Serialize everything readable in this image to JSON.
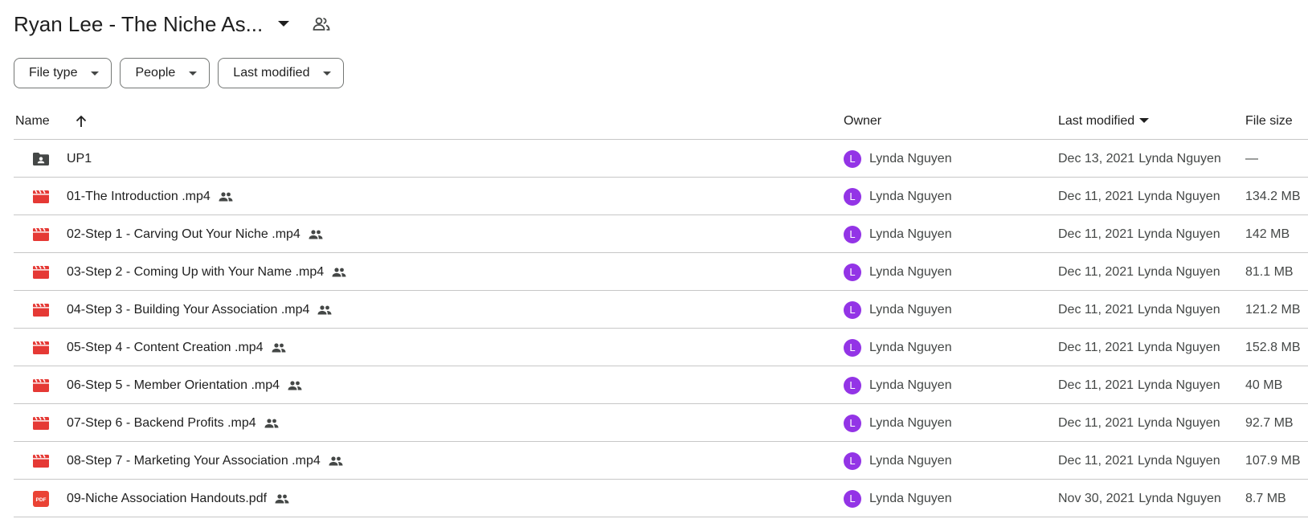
{
  "header": {
    "title": "Ryan Lee - The Niche As...",
    "title_caret_icon": "arrow-drop-down-icon",
    "shared_icon": "shared-folder-icon"
  },
  "filters": [
    {
      "label": "File type"
    },
    {
      "label": "People"
    },
    {
      "label": "Last modified"
    }
  ],
  "columns": {
    "name": "Name",
    "owner": "Owner",
    "last_modified": "Last modified",
    "file_size": "File size"
  },
  "sort": {
    "column": "Name",
    "direction": "ascending",
    "icon": "arrow-upward-icon"
  },
  "colors": {
    "accent_avatar": "#9334e6",
    "video_icon": "#e53935",
    "pdf_icon": "#ea4335",
    "folder_icon": "#444746"
  },
  "rows": [
    {
      "type": "shared-folder",
      "name": "UP1",
      "shared": false,
      "owner_initial": "L",
      "owner": "Lynda Nguyen",
      "modified_date": "Dec 13, 2021",
      "modified_by": "Lynda Nguyen",
      "size": "—"
    },
    {
      "type": "video",
      "name": "01-The Introduction .mp4",
      "shared": true,
      "owner_initial": "L",
      "owner": "Lynda Nguyen",
      "modified_date": "Dec 11, 2021",
      "modified_by": "Lynda Nguyen",
      "size": "134.2 MB"
    },
    {
      "type": "video",
      "name": "02-Step 1 - Carving Out Your Niche .mp4",
      "shared": true,
      "owner_initial": "L",
      "owner": "Lynda Nguyen",
      "modified_date": "Dec 11, 2021",
      "modified_by": "Lynda Nguyen",
      "size": "142 MB"
    },
    {
      "type": "video",
      "name": "03-Step 2 - Coming Up with Your Name .mp4",
      "shared": true,
      "owner_initial": "L",
      "owner": "Lynda Nguyen",
      "modified_date": "Dec 11, 2021",
      "modified_by": "Lynda Nguyen",
      "size": "81.1 MB"
    },
    {
      "type": "video",
      "name": "04-Step 3 - Building Your Association .mp4",
      "shared": true,
      "owner_initial": "L",
      "owner": "Lynda Nguyen",
      "modified_date": "Dec 11, 2021",
      "modified_by": "Lynda Nguyen",
      "size": "121.2 MB"
    },
    {
      "type": "video",
      "name": "05-Step 4 - Content Creation .mp4",
      "shared": true,
      "owner_initial": "L",
      "owner": "Lynda Nguyen",
      "modified_date": "Dec 11, 2021",
      "modified_by": "Lynda Nguyen",
      "size": "152.8 MB"
    },
    {
      "type": "video",
      "name": "06-Step 5 - Member Orientation .mp4",
      "shared": true,
      "owner_initial": "L",
      "owner": "Lynda Nguyen",
      "modified_date": "Dec 11, 2021",
      "modified_by": "Lynda Nguyen",
      "size": "40 MB"
    },
    {
      "type": "video",
      "name": "07-Step 6 - Backend Profits .mp4",
      "shared": true,
      "owner_initial": "L",
      "owner": "Lynda Nguyen",
      "modified_date": "Dec 11, 2021",
      "modified_by": "Lynda Nguyen",
      "size": "92.7 MB"
    },
    {
      "type": "video",
      "name": "08-Step 7 - Marketing Your Association .mp4",
      "shared": true,
      "owner_initial": "L",
      "owner": "Lynda Nguyen",
      "modified_date": "Dec 11, 2021",
      "modified_by": "Lynda Nguyen",
      "size": "107.9 MB"
    },
    {
      "type": "pdf",
      "name": "09-Niche Association Handouts.pdf",
      "shared": true,
      "owner_initial": "L",
      "owner": "Lynda Nguyen",
      "modified_date": "Nov 30, 2021",
      "modified_by": "Lynda Nguyen",
      "size": "8.7 MB"
    }
  ]
}
